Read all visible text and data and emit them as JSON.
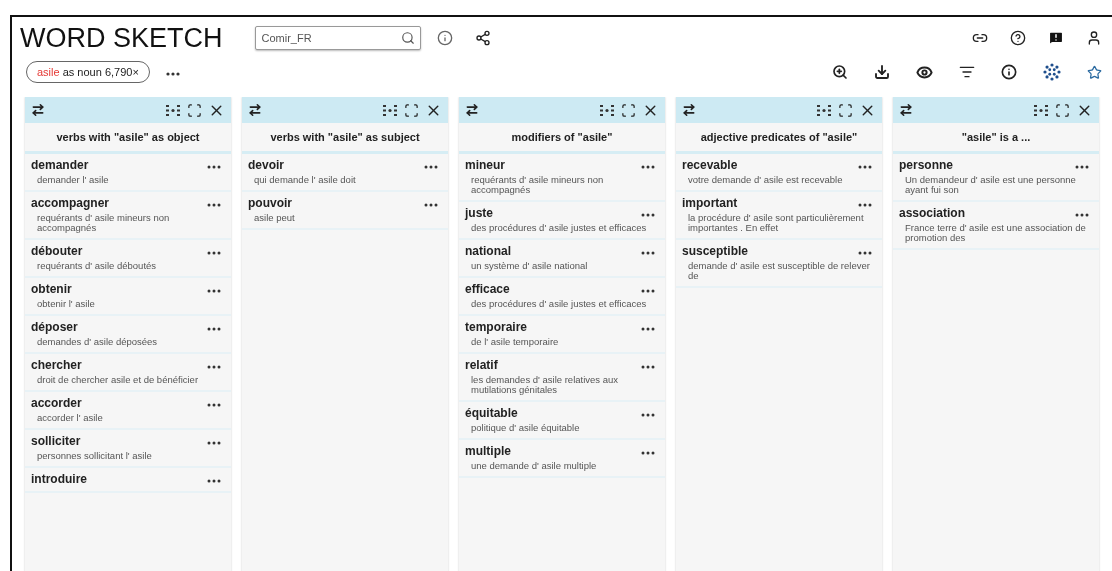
{
  "app_title": "WORD SKETCH",
  "corpus_field": {
    "value": "Comir_FR"
  },
  "query_chip": {
    "lemma": "asile",
    "rest": "as noun 6,790×"
  },
  "panels": [
    {
      "title": "verbs with \"asile\" as object",
      "rows": [
        {
          "word": "demander",
          "example": "demander l' asile"
        },
        {
          "word": "accompagner",
          "example": "requérants d' asile mineurs non accompagnés"
        },
        {
          "word": "débouter",
          "example": "requérants d' asile déboutés"
        },
        {
          "word": "obtenir",
          "example": "obtenir l' asile"
        },
        {
          "word": "déposer",
          "example": "demandes d' asile déposées"
        },
        {
          "word": "chercher",
          "example": "droit de chercher asile et de bénéficier"
        },
        {
          "word": "accorder",
          "example": "accorder l' asile"
        },
        {
          "word": "solliciter",
          "example": "personnes sollicitant l' asile"
        },
        {
          "word": "introduire"
        }
      ]
    },
    {
      "title": "verbs with \"asile\" as subject",
      "rows": [
        {
          "word": "devoir",
          "example": "qui demande l' asile doit"
        },
        {
          "word": "pouvoir",
          "example": "asile peut"
        }
      ]
    },
    {
      "title": "modifiers of \"asile\"",
      "rows": [
        {
          "word": "mineur",
          "example": "requérants d' asile mineurs non accompagnés"
        },
        {
          "word": "juste",
          "example": "des procédures d' asile justes et efficaces"
        },
        {
          "word": "national",
          "example": "un système d' asile national"
        },
        {
          "word": "efficace",
          "example": "des procédures d' asile justes et efficaces"
        },
        {
          "word": "temporaire",
          "example": "de l' asile temporaire"
        },
        {
          "word": "relatif",
          "example": "les demandes d' asile relatives aux mutilations génitales"
        },
        {
          "word": "équitable",
          "example": "politique d' asile équitable"
        },
        {
          "word": "multiple",
          "example": "une demande d' asile multiple"
        }
      ]
    },
    {
      "title": "adjective predicates of \"asile\"",
      "rows": [
        {
          "word": "recevable",
          "example": "votre demande d' asile est recevable"
        },
        {
          "word": "important",
          "example": "la procédure d' asile sont particulièrement importantes . En effet"
        },
        {
          "word": "susceptible",
          "example": "demande d' asile est susceptible de relever de"
        }
      ]
    },
    {
      "title": "\"asile\" is a ...",
      "rows": [
        {
          "word": "personne",
          "example": "Un demandeur d' asile est une personne ayant fui son"
        },
        {
          "word": "association",
          "example": "France terre d' asile est une association de promotion des"
        }
      ]
    }
  ]
}
